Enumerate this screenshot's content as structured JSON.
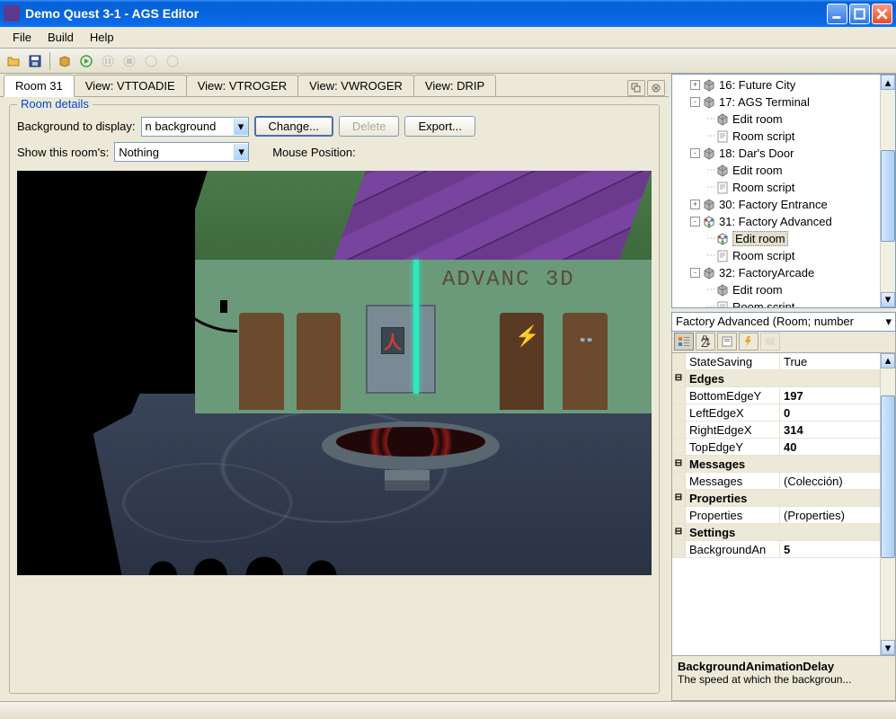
{
  "window": {
    "title": "Demo Quest 3-1 - AGS Editor"
  },
  "menu": {
    "file": "File",
    "build": "Build",
    "help": "Help"
  },
  "tabs": {
    "items": [
      "Room 31",
      "View: VTTOADIE",
      "View: VTROGER",
      "View: VWROGER",
      "View: DRIP"
    ],
    "active": 0
  },
  "roomPanel": {
    "groupLabel": "Room details",
    "bgLabel": "Background to display:",
    "bgValue": "n background",
    "changeBtn": "Change...",
    "deleteBtn": "Delete",
    "exportBtn": "Export...",
    "showLabel": "Show this room's:",
    "showValue": "Nothing",
    "mousePosLabel": "Mouse Position:",
    "wallText": "ADVANC 3D"
  },
  "tree": {
    "nodes": [
      {
        "indent": 1,
        "toggle": "+",
        "icon": "cube",
        "label": "16: Future City"
      },
      {
        "indent": 1,
        "toggle": "-",
        "icon": "cube",
        "label": "17: AGS Terminal"
      },
      {
        "indent": 2,
        "toggle": "",
        "icon": "cube",
        "label": "Edit room"
      },
      {
        "indent": 2,
        "toggle": "",
        "icon": "script",
        "label": "Room script"
      },
      {
        "indent": 1,
        "toggle": "-",
        "icon": "cube",
        "label": "18: Dar's Door"
      },
      {
        "indent": 2,
        "toggle": "",
        "icon": "cube",
        "label": "Edit room"
      },
      {
        "indent": 2,
        "toggle": "",
        "icon": "script",
        "label": "Room script"
      },
      {
        "indent": 1,
        "toggle": "+",
        "icon": "cube",
        "label": "30: Factory Entrance"
      },
      {
        "indent": 1,
        "toggle": "-",
        "icon": "cubec",
        "label": "31: Factory Advanced"
      },
      {
        "indent": 2,
        "toggle": "",
        "icon": "cubec",
        "label": "Edit room",
        "selected": true
      },
      {
        "indent": 2,
        "toggle": "",
        "icon": "script",
        "label": "Room script"
      },
      {
        "indent": 1,
        "toggle": "-",
        "icon": "cube",
        "label": "32: FactoryArcade"
      },
      {
        "indent": 2,
        "toggle": "",
        "icon": "cube",
        "label": "Edit room"
      },
      {
        "indent": 2,
        "toggle": "",
        "icon": "script",
        "label": "Room script"
      }
    ]
  },
  "propHeader": "Factory Advanced (Room; number",
  "props": {
    "rows": [
      {
        "type": "plain",
        "name": "StateSaving",
        "value": "True"
      },
      {
        "type": "cat",
        "name": "Edges"
      },
      {
        "type": "prop",
        "name": "BottomEdgeY",
        "value": "197"
      },
      {
        "type": "prop",
        "name": "LeftEdgeX",
        "value": "0"
      },
      {
        "type": "prop",
        "name": "RightEdgeX",
        "value": "314"
      },
      {
        "type": "prop",
        "name": "TopEdgeY",
        "value": "40"
      },
      {
        "type": "cat",
        "name": "Messages"
      },
      {
        "type": "plain",
        "name": "Messages",
        "value": "(Colección)"
      },
      {
        "type": "cat",
        "name": "Properties"
      },
      {
        "type": "plain",
        "name": "Properties",
        "value": "(Properties)"
      },
      {
        "type": "cat",
        "name": "Settings"
      },
      {
        "type": "prop",
        "name": "BackgroundAn",
        "value": "5"
      }
    ],
    "help": {
      "name": "BackgroundAnimationDelay",
      "desc": "The speed at which the backgroun..."
    }
  }
}
